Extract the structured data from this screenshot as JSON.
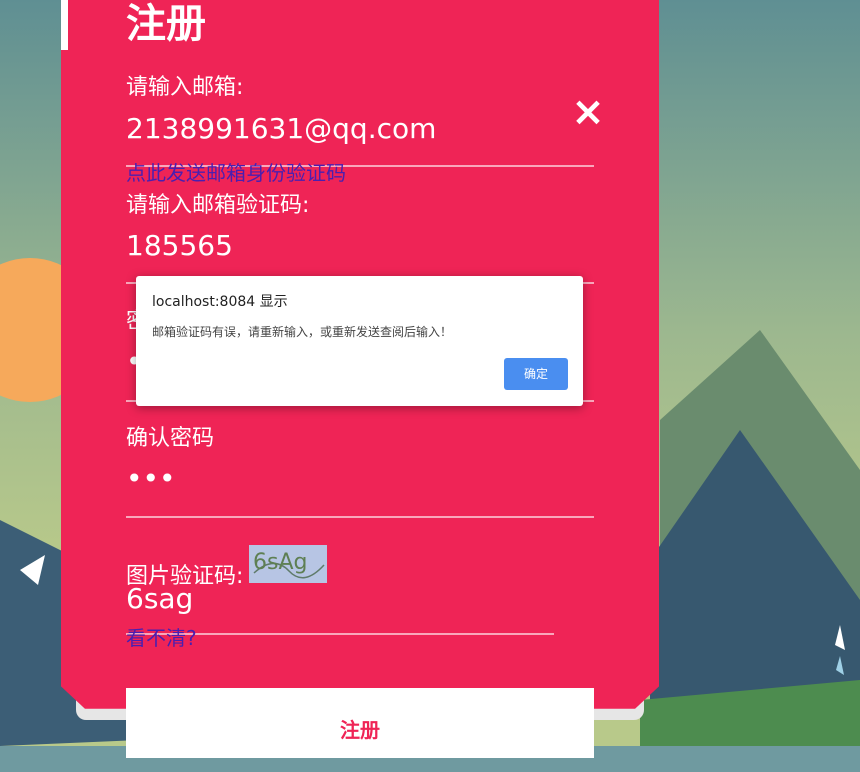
{
  "form": {
    "title": "注册",
    "email_label": "请输入邮箱:",
    "email_value": "2138991631@qq.com",
    "send_code_link": "点此发送邮箱身份验证码",
    "email_code_label": "请输入邮箱验证码:",
    "email_code_value": "185565",
    "password_label": "密码",
    "password_value": "•••",
    "confirm_password_label": "确认密码",
    "confirm_password_value": "•••",
    "captcha_label": "图片验证码:",
    "captcha_value": "6sag",
    "refresh_captcha_link": "看不清?",
    "submit_label": "注册",
    "close_icon_text": "×"
  },
  "dialog": {
    "title": "localhost:8084 显示",
    "message": "邮箱验证码有误，请重新输入，或重新发送查阅后输入！",
    "ok_label": "确定"
  },
  "captcha_image_text": "6sAg",
  "colors": {
    "form_bg": "#ef2456",
    "dialog_btn": "#4a8ef0",
    "link": "#4a1fb0"
  }
}
